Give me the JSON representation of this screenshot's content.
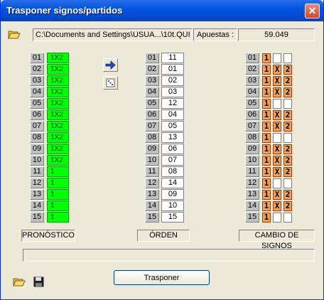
{
  "window": {
    "title": "Trasponer signos/partidos",
    "close_glyph": "✕"
  },
  "path": "C:\\Documents and Settings\\USUA...\\10t.QUI",
  "apuestas": {
    "label": "Apuestas :",
    "value": "59.049"
  },
  "row_numbers": [
    "01",
    "02",
    "03",
    "04",
    "05",
    "06",
    "07",
    "08",
    "09",
    "10",
    "11",
    "12",
    "13",
    "14",
    "15"
  ],
  "pronostico": [
    "1X2",
    "1X2",
    "1X2",
    "1X2",
    "1X2",
    "1X2",
    "1X2",
    "1X2",
    "1X2",
    "1X2",
    "1",
    "1",
    "1",
    "1",
    "1"
  ],
  "orden": [
    "11",
    "01",
    "02",
    "03",
    "12",
    "04",
    "05",
    "13",
    "06",
    "07",
    "08",
    "14",
    "09",
    "10",
    "15"
  ],
  "cambio_signos": [
    [
      "1"
    ],
    [
      "1",
      "X",
      "2"
    ],
    [
      "1",
      "X",
      "2"
    ],
    [
      "1",
      "X",
      "2"
    ],
    [
      "1"
    ],
    [
      "1",
      "X",
      "2"
    ],
    [
      "1",
      "X",
      "2"
    ],
    [
      "1"
    ],
    [
      "1",
      "X",
      "2"
    ],
    [
      "1",
      "X",
      "2"
    ],
    [
      "1",
      "X",
      "2"
    ],
    [
      "1"
    ],
    [
      "1",
      "X",
      "2"
    ],
    [
      "1",
      "X",
      "2"
    ],
    [
      "1"
    ]
  ],
  "labels": {
    "pronostico": "PRONÓSTICO",
    "orden": "ÓRDEN",
    "cambio": "CAMBIO DE SIGNOS"
  },
  "buttons": {
    "trasponer": "Trasponer"
  },
  "icons": {
    "open": "open-folder-icon",
    "save": "floppy-disk-icon",
    "arrow": "arrow-right-icon",
    "random": "dice-icon"
  },
  "colors": {
    "green": "#00ff00",
    "sign": "#f0a060",
    "title": "#0055e3"
  }
}
